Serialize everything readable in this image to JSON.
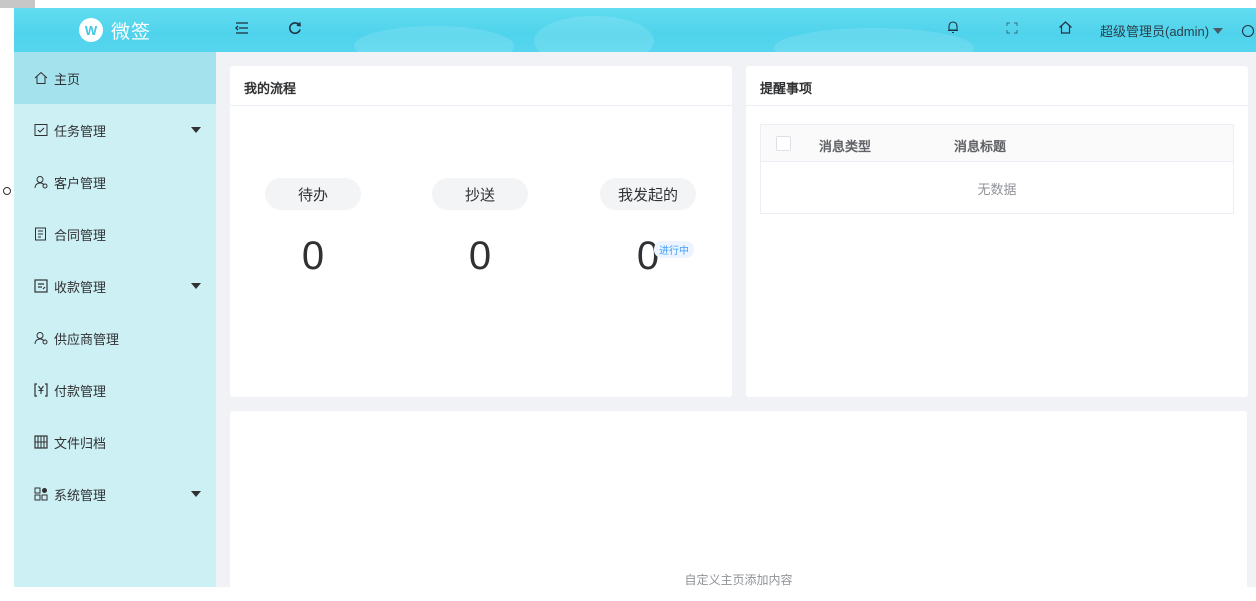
{
  "header": {
    "brand": "微签",
    "logo_letter": "W",
    "user": "超级管理员(admin)"
  },
  "sidebar": {
    "items": [
      {
        "label": "主页"
      },
      {
        "label": "任务管理"
      },
      {
        "label": "客户管理"
      },
      {
        "label": "合同管理"
      },
      {
        "label": "收款管理"
      },
      {
        "label": "供应商管理"
      },
      {
        "label": "付款管理"
      },
      {
        "label": "文件归档"
      },
      {
        "label": "系统管理"
      }
    ]
  },
  "flow": {
    "title": "我的流程",
    "todo_label": "待办",
    "todo_count": "0",
    "cc_label": "抄送",
    "cc_count": "0",
    "mine_label": "我发起的",
    "mine_count": "0",
    "mine_badge": "进行中"
  },
  "reminders": {
    "title": "提醒事项",
    "col_type": "消息类型",
    "col_title": "消息标题",
    "empty": "无数据"
  },
  "custom": {
    "tip": "自定义主页添加内容"
  },
  "colors": {
    "header": "#4fd3ec",
    "sidebar": "#cdf0f5",
    "sidebar_active": "#a4e2ed"
  }
}
